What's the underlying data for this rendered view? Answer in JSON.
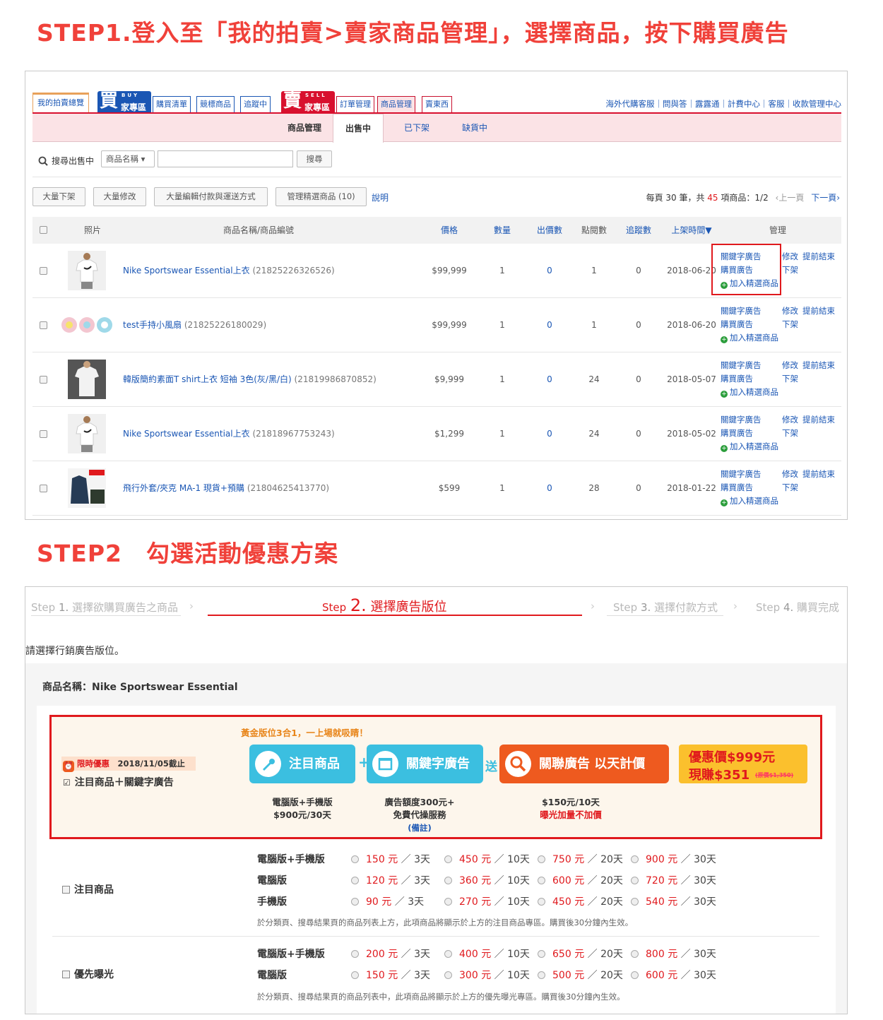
{
  "step1_title": "STEP1.登入至「我的拍賣>賣家商品管理」，選擇商品，按下購買廣告",
  "step2_title": "STEP2　勾選活動優惠方案",
  "nav": {
    "overview": "我的拍賣總覽",
    "buy_logo": {
      "big": "買",
      "sub": "BUY",
      "label": "家專區"
    },
    "buy_tabs": [
      "購買清單",
      "競標商品",
      "追蹤中"
    ],
    "sell_logo": {
      "big": "賣",
      "sub": "SELL",
      "label": "家專區"
    },
    "sell_tabs": [
      "訂單管理",
      "商品管理",
      "賣東西"
    ],
    "links": "海外代購客服｜問與答｜露露通｜計費中心｜客服｜收款管理中心"
  },
  "subtabs": {
    "manage": "商品管理",
    "selling": "出售中",
    "off": "已下架",
    "out": "缺貨中"
  },
  "search": {
    "label": "搜尋出售中",
    "select": "商品名稱 ▾",
    "button": "搜尋",
    "placeholder": ""
  },
  "toolbar": {
    "bulk_off": "大量下架",
    "bulk_edit": "大量修改",
    "bulk_pay": "大量編輯付款與運送方式",
    "manage_featured": "管理精選商品 (10)",
    "help": "說明",
    "pagination_prefix": "每頁 30 筆，共 ",
    "total": "45",
    "pagination_suffix": " 項商品：1/2",
    "prev": "‹上一頁",
    "next": "下一頁›"
  },
  "table_headers": {
    "photo": "照片",
    "name": "商品名稱/商品編號",
    "price": "價格",
    "qty": "數量",
    "bids": "出價數",
    "views": "點閱數",
    "track": "追蹤數",
    "date": "上架時間▼",
    "manage": "管理"
  },
  "rows": [
    {
      "name": "Nike Sportswear Essential上衣",
      "id": "(21825226326526)",
      "price": "$99,999",
      "qty": "1",
      "bids": "0",
      "views": "1",
      "track": "0",
      "date": "2018-06-20",
      "thumb": "tshirt-model"
    },
    {
      "name": "test手持小風扇",
      "id": "(21825226180029)",
      "price": "$99,999",
      "qty": "1",
      "bids": "0",
      "views": "1",
      "track": "0",
      "date": "2018-06-20",
      "thumb": "fans"
    },
    {
      "name": "韓版簡約素面T shirt上衣 短袖 3色(灰/黑/白)",
      "id": "(21819986870852)",
      "price": "$9,999",
      "qty": "1",
      "bids": "0",
      "views": "24",
      "track": "0",
      "date": "2018-05-07",
      "thumb": "tee-man"
    },
    {
      "name": "Nike Sportswear Essential上衣",
      "id": "(21818967753243)",
      "price": "$1,299",
      "qty": "1",
      "bids": "0",
      "views": "24",
      "track": "0",
      "date": "2018-05-02",
      "thumb": "tshirt-model"
    },
    {
      "name": "飛行外套/夾克 MA-1 現貨+預購",
      "id": "(21804625413770)",
      "price": "$599",
      "qty": "1",
      "bids": "0",
      "views": "28",
      "track": "0",
      "date": "2018-01-22",
      "thumb": "jacket"
    }
  ],
  "manage_links": {
    "keyword_ad": "關鍵字廣告",
    "buy_ad": "購買廣告",
    "add_featured": "加入精選商品",
    "edit": "修改",
    "end_early": "提前結束",
    "off": "下架"
  },
  "wizard": {
    "s1": {
      "step": "Step",
      "num": "1.",
      "label": "選擇欲購買廣告之商品"
    },
    "s2": {
      "step": "Step",
      "num": "2.",
      "label": "選擇廣告版位"
    },
    "s3": {
      "step": "Step",
      "num": "3.",
      "label": "選擇付款方式"
    },
    "s4": {
      "step": "Step",
      "num": "4.",
      "label": "購買完成"
    }
  },
  "instruction": "請選擇行銷廣告版位。",
  "product_name_label": "商品名稱：Nike Sportswear Essential",
  "promo": {
    "badge": "限時優惠",
    "deadline": "2018/11/05截止",
    "checkbox_label": "注目商品＋關鍵字廣告",
    "headline": "黃金版位3合1，一上場就吸睛！",
    "pill1": "注目商品",
    "pill2": "關鍵字廣告",
    "plus": "+",
    "gift": "送",
    "pill3": "關聯廣告 以天計價",
    "price_line1": "優惠價$999元",
    "price_line2": "現賺$351",
    "orig_price": "(原價$1,350)",
    "d1a": "電腦版+手機版",
    "d1b": "$900元/30天",
    "d2a": "廣告額度300元+",
    "d2b": "免費代操服務",
    "d2c": "(備註)",
    "d3a": "$150元/10天",
    "d3b": "曝光加量不加價"
  },
  "featured": {
    "label": "注目商品",
    "rows": [
      {
        "platform": "電腦版+手機版",
        "prices": [
          "150",
          "450",
          "750",
          "900"
        ]
      },
      {
        "platform": "電腦版",
        "prices": [
          "120",
          "360",
          "600",
          "720"
        ]
      },
      {
        "platform": "手機版",
        "prices": [
          "90",
          "270",
          "450",
          "540"
        ]
      }
    ],
    "note": "於分類頁、搜尋結果頁的商品列表上方，此項商品將顯示於上方的注目商品專區。購買後30分鐘內生效。"
  },
  "priority": {
    "label": "優先曝光",
    "rows": [
      {
        "platform": "電腦版+手機版",
        "prices": [
          "200",
          "400",
          "650",
          "800"
        ]
      },
      {
        "platform": "電腦版",
        "prices": [
          "150",
          "300",
          "500",
          "600"
        ]
      }
    ],
    "note": "於分類頁、搜尋結果頁的商品列表中，此項商品將顯示於上方的優先曝光專區。購買後30分鐘內生效。"
  },
  "durations": [
    "3天",
    "10天",
    "20天",
    "30天"
  ],
  "currency": "元",
  "colors": {
    "accent": "#f0413a",
    "link": "#1a56b4",
    "pink_bar": "#fbe3e6",
    "highlight_box": "#e0191d",
    "pill_blue": "#3bbfe0",
    "pill_orange": "#ee5a1f",
    "price_yellow": "#fbc02d"
  }
}
